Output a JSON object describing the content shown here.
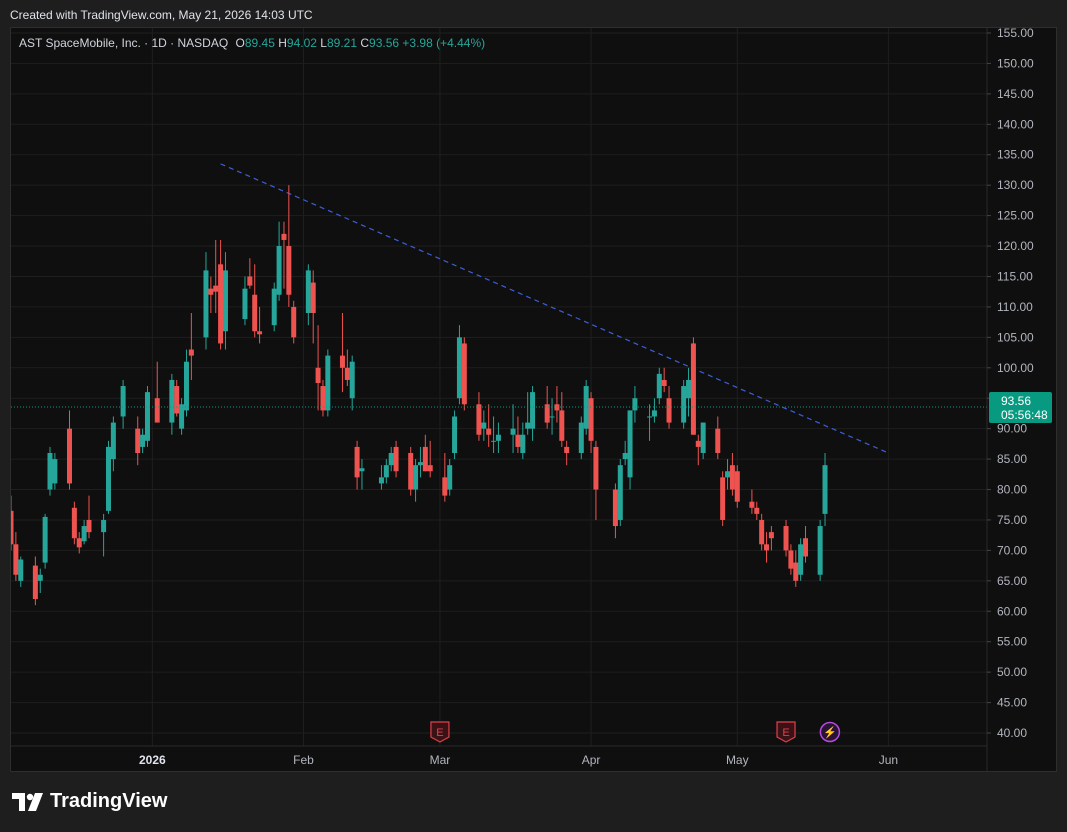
{
  "header": {
    "created_text": "Created with TradingView.com, May 21, 2026 14:03 UTC"
  },
  "legend": {
    "symbol": "AST SpaceMobile, Inc. · 1D · NASDAQ",
    "o_label": "O",
    "o_value": "89.45",
    "h_label": "H",
    "h_value": "94.02",
    "l_label": "L",
    "l_value": "89.21",
    "c_label": "C",
    "c_value": "93.56",
    "change": "+3.98 (+4.44%)"
  },
  "price_tag": {
    "price": "93.56",
    "countdown": "05:56:48"
  },
  "footer": {
    "brand": "TradingView"
  },
  "colors": {
    "up": "#26a69a",
    "down": "#ef5350",
    "trendline": "#3d5fd9",
    "background": "#0f0f0f",
    "event": "#e0404a",
    "dividend": "#b44cde"
  },
  "chart_data": {
    "type": "candlestick",
    "title": "AST SpaceMobile, Inc. · 1D · NASDAQ",
    "ylim": [
      40,
      155
    ],
    "y_ticks": [
      "155.00",
      "150.00",
      "145.00",
      "140.00",
      "135.00",
      "130.00",
      "125.00",
      "120.00",
      "115.00",
      "110.00",
      "105.00",
      "100.00",
      "95.00",
      "90.00",
      "85.00",
      "80.00",
      "75.00",
      "70.00",
      "65.00",
      "60.00",
      "55.00",
      "50.00",
      "45.00",
      "40.00"
    ],
    "x_ticks": [
      {
        "label": "2026",
        "date": "2026-01-01",
        "bold": true
      },
      {
        "label": "Feb",
        "date": "2026-02-01",
        "bold": false
      },
      {
        "label": "Mar",
        "date": "2026-03-01",
        "bold": false
      },
      {
        "label": "Apr",
        "date": "2026-04-01",
        "bold": false
      },
      {
        "label": "May",
        "date": "2026-05-01",
        "bold": false
      },
      {
        "label": "Jun",
        "date": "2026-06-01",
        "bold": false
      }
    ],
    "x_range": [
      "2025-12-03",
      "2026-06-20"
    ],
    "grid": true,
    "current_price": 93.56,
    "trendline": {
      "style": "dashed",
      "start": {
        "date": "2026-01-15",
        "price": 133.5
      },
      "end": {
        "date": "2026-06-01",
        "price": 86.0
      }
    },
    "events": [
      {
        "date": "2026-03-01",
        "type": "earnings",
        "label": "E"
      },
      {
        "date": "2026-05-11",
        "type": "earnings",
        "label": "E"
      },
      {
        "date": "2026-05-20",
        "type": "dividend",
        "label": "⚡"
      }
    ],
    "candles": [
      {
        "date": "2025-12-03",
        "o": 76.5,
        "h": 79,
        "l": 70,
        "c": 71
      },
      {
        "date": "2025-12-04",
        "o": 71,
        "h": 73,
        "l": 65,
        "c": 66
      },
      {
        "date": "2025-12-05",
        "o": 65,
        "h": 69,
        "l": 64,
        "c": 68.5
      },
      {
        "date": "2025-12-08",
        "o": 67.5,
        "h": 69,
        "l": 61,
        "c": 62
      },
      {
        "date": "2025-12-09",
        "o": 65,
        "h": 67,
        "l": 63,
        "c": 66
      },
      {
        "date": "2025-12-10",
        "o": 68,
        "h": 76,
        "l": 67,
        "c": 75.5
      },
      {
        "date": "2025-12-11",
        "o": 80,
        "h": 87,
        "l": 79,
        "c": 86
      },
      {
        "date": "2025-12-12",
        "o": 81,
        "h": 86,
        "l": 80,
        "c": 85
      },
      {
        "date": "2025-12-15",
        "o": 90,
        "h": 93,
        "l": 80,
        "c": 81
      },
      {
        "date": "2025-12-16",
        "o": 77,
        "h": 78,
        "l": 71,
        "c": 72
      },
      {
        "date": "2025-12-17",
        "o": 72,
        "h": 73,
        "l": 69.5,
        "c": 70.5
      },
      {
        "date": "2025-12-18",
        "o": 71.5,
        "h": 75,
        "l": 71,
        "c": 74
      },
      {
        "date": "2025-12-19",
        "o": 75,
        "h": 79,
        "l": 72,
        "c": 73
      },
      {
        "date": "2025-12-22",
        "o": 73,
        "h": 76,
        "l": 69,
        "c": 75
      },
      {
        "date": "2025-12-23",
        "o": 76.5,
        "h": 88,
        "l": 76,
        "c": 87
      },
      {
        "date": "2025-12-24",
        "o": 85,
        "h": 92,
        "l": 83,
        "c": 91
      },
      {
        "date": "2025-12-26",
        "o": 92,
        "h": 98,
        "l": 90,
        "c": 97
      },
      {
        "date": "2025-12-29",
        "o": 90,
        "h": 92,
        "l": 84,
        "c": 86
      },
      {
        "date": "2025-12-30",
        "o": 87,
        "h": 90,
        "l": 86,
        "c": 89
      },
      {
        "date": "2025-12-31",
        "o": 88,
        "h": 97,
        "l": 87,
        "c": 96
      },
      {
        "date": "2026-01-02",
        "o": 95,
        "h": 101,
        "l": 91,
        "c": 91
      },
      {
        "date": "2026-01-05",
        "o": 91,
        "h": 99,
        "l": 89,
        "c": 98
      },
      {
        "date": "2026-01-06",
        "o": 97,
        "h": 98,
        "l": 92,
        "c": 92.5
      },
      {
        "date": "2026-01-07",
        "o": 90,
        "h": 95,
        "l": 89,
        "c": 94
      },
      {
        "date": "2026-01-08",
        "o": 93,
        "h": 103,
        "l": 92,
        "c": 101
      },
      {
        "date": "2026-01-09",
        "o": 103,
        "h": 109,
        "l": 98,
        "c": 102
      },
      {
        "date": "2026-01-12",
        "o": 105,
        "h": 119,
        "l": 103,
        "c": 116
      },
      {
        "date": "2026-01-13",
        "o": 113,
        "h": 115,
        "l": 109,
        "c": 112
      },
      {
        "date": "2026-01-14",
        "o": 113.5,
        "h": 121,
        "l": 109,
        "c": 112.5
      },
      {
        "date": "2026-01-15",
        "o": 117,
        "h": 121,
        "l": 103,
        "c": 104
      },
      {
        "date": "2026-01-16",
        "o": 106,
        "h": 119,
        "l": 103,
        "c": 116
      },
      {
        "date": "2026-01-20",
        "o": 108,
        "h": 115,
        "l": 107,
        "c": 113
      },
      {
        "date": "2026-01-21",
        "o": 115,
        "h": 118,
        "l": 113,
        "c": 113.5
      },
      {
        "date": "2026-01-22",
        "o": 112,
        "h": 117,
        "l": 105,
        "c": 106
      },
      {
        "date": "2026-01-23",
        "o": 106,
        "h": 110,
        "l": 104,
        "c": 105.5
      },
      {
        "date": "2026-01-26",
        "o": 107,
        "h": 114,
        "l": 106,
        "c": 113
      },
      {
        "date": "2026-01-27",
        "o": 112,
        "h": 124,
        "l": 111,
        "c": 120
      },
      {
        "date": "2026-01-28",
        "o": 122,
        "h": 124,
        "l": 113,
        "c": 121
      },
      {
        "date": "2026-01-29",
        "o": 120,
        "h": 130,
        "l": 110,
        "c": 112
      },
      {
        "date": "2026-01-30",
        "o": 110,
        "h": 111,
        "l": 104,
        "c": 105
      },
      {
        "date": "2026-02-02",
        "o": 109,
        "h": 117,
        "l": 107,
        "c": 116
      },
      {
        "date": "2026-02-03",
        "o": 114,
        "h": 116,
        "l": 104,
        "c": 109
      },
      {
        "date": "2026-02-04",
        "o": 100,
        "h": 107,
        "l": 93,
        "c": 97.5
      },
      {
        "date": "2026-02-05",
        "o": 97,
        "h": 98,
        "l": 92,
        "c": 93
      },
      {
        "date": "2026-02-06",
        "o": 93,
        "h": 103,
        "l": 92,
        "c": 102
      },
      {
        "date": "2026-02-09",
        "o": 102,
        "h": 109,
        "l": 96,
        "c": 100
      },
      {
        "date": "2026-02-10",
        "o": 100,
        "h": 103,
        "l": 97,
        "c": 98
      },
      {
        "date": "2026-02-11",
        "o": 95,
        "h": 102,
        "l": 93,
        "c": 101
      },
      {
        "date": "2026-02-12",
        "o": 87,
        "h": 88,
        "l": 80,
        "c": 82
      },
      {
        "date": "2026-02-13",
        "o": 83,
        "h": 85,
        "l": 80,
        "c": 83.5
      },
      {
        "date": "2026-02-17",
        "o": 81,
        "h": 84,
        "l": 80,
        "c": 82
      },
      {
        "date": "2026-02-18",
        "o": 82,
        "h": 85,
        "l": 81,
        "c": 84
      },
      {
        "date": "2026-02-19",
        "o": 84,
        "h": 87,
        "l": 83,
        "c": 86
      },
      {
        "date": "2026-02-20",
        "o": 87,
        "h": 88,
        "l": 82,
        "c": 83
      },
      {
        "date": "2026-02-23",
        "o": 86,
        "h": 87,
        "l": 79,
        "c": 80
      },
      {
        "date": "2026-02-24",
        "o": 80,
        "h": 85,
        "l": 78,
        "c": 84
      },
      {
        "date": "2026-02-25",
        "o": 84,
        "h": 87,
        "l": 82,
        "c": 84.5
      },
      {
        "date": "2026-02-26",
        "o": 87,
        "h": 89,
        "l": 83,
        "c": 83
      },
      {
        "date": "2026-02-27",
        "o": 84,
        "h": 88,
        "l": 82,
        "c": 83
      },
      {
        "date": "2026-03-02",
        "o": 82,
        "h": 86,
        "l": 78,
        "c": 79
      },
      {
        "date": "2026-03-03",
        "o": 80,
        "h": 85,
        "l": 79,
        "c": 84
      },
      {
        "date": "2026-03-04",
        "o": 86,
        "h": 93,
        "l": 85,
        "c": 92
      },
      {
        "date": "2026-03-05",
        "o": 95,
        "h": 107,
        "l": 94,
        "c": 105
      },
      {
        "date": "2026-03-06",
        "o": 104,
        "h": 105,
        "l": 93,
        "c": 94
      },
      {
        "date": "2026-03-09",
        "o": 94,
        "h": 96,
        "l": 88,
        "c": 89
      },
      {
        "date": "2026-03-10",
        "o": 90,
        "h": 93,
        "l": 88,
        "c": 91
      },
      {
        "date": "2026-03-11",
        "o": 90,
        "h": 94,
        "l": 87,
        "c": 89
      },
      {
        "date": "2026-03-12",
        "o": 88,
        "h": 92,
        "l": 86,
        "c": 88
      },
      {
        "date": "2026-03-13",
        "o": 88,
        "h": 91,
        "l": 86,
        "c": 89
      },
      {
        "date": "2026-03-16",
        "o": 89,
        "h": 94,
        "l": 86,
        "c": 90
      },
      {
        "date": "2026-03-17",
        "o": 89,
        "h": 92,
        "l": 86,
        "c": 87
      },
      {
        "date": "2026-03-18",
        "o": 86,
        "h": 91,
        "l": 85,
        "c": 89
      },
      {
        "date": "2026-03-19",
        "o": 90,
        "h": 96,
        "l": 89,
        "c": 91
      },
      {
        "date": "2026-03-20",
        "o": 90,
        "h": 97,
        "l": 88,
        "c": 96
      },
      {
        "date": "2026-03-23",
        "o": 94,
        "h": 97,
        "l": 90,
        "c": 91
      },
      {
        "date": "2026-03-24",
        "o": 92,
        "h": 95,
        "l": 89,
        "c": 92
      },
      {
        "date": "2026-03-25",
        "o": 94,
        "h": 97,
        "l": 91,
        "c": 93
      },
      {
        "date": "2026-03-26",
        "o": 93,
        "h": 96,
        "l": 87,
        "c": 88
      },
      {
        "date": "2026-03-27",
        "o": 87,
        "h": 88,
        "l": 84,
        "c": 86
      },
      {
        "date": "2026-03-30",
        "o": 86,
        "h": 92,
        "l": 85,
        "c": 91
      },
      {
        "date": "2026-03-31",
        "o": 90,
        "h": 98,
        "l": 89,
        "c": 97
      },
      {
        "date": "2026-04-01",
        "o": 95,
        "h": 96,
        "l": 86,
        "c": 88
      },
      {
        "date": "2026-04-02",
        "o": 87,
        "h": 88,
        "l": 75,
        "c": 80
      },
      {
        "date": "2026-04-06",
        "o": 80,
        "h": 81,
        "l": 72,
        "c": 74
      },
      {
        "date": "2026-04-07",
        "o": 75,
        "h": 85,
        "l": 74,
        "c": 84
      },
      {
        "date": "2026-04-08",
        "o": 85,
        "h": 88,
        "l": 84,
        "c": 86
      },
      {
        "date": "2026-04-09",
        "o": 82,
        "h": 93,
        "l": 80,
        "c": 93
      },
      {
        "date": "2026-04-10",
        "o": 93,
        "h": 97,
        "l": 91,
        "c": 95
      },
      {
        "date": "2026-04-13",
        "o": 92,
        "h": 94,
        "l": 88,
        "c": 92
      },
      {
        "date": "2026-04-14",
        "o": 92,
        "h": 95,
        "l": 91,
        "c": 93
      },
      {
        "date": "2026-04-15",
        "o": 95,
        "h": 100,
        "l": 94,
        "c": 99
      },
      {
        "date": "2026-04-16",
        "o": 98,
        "h": 100,
        "l": 96,
        "c": 97
      },
      {
        "date": "2026-04-17",
        "o": 95,
        "h": 97,
        "l": 90,
        "c": 91
      },
      {
        "date": "2026-04-20",
        "o": 91,
        "h": 98,
        "l": 90,
        "c": 97
      },
      {
        "date": "2026-04-21",
        "o": 95,
        "h": 100,
        "l": 92,
        "c": 98
      },
      {
        "date": "2026-04-22",
        "o": 104,
        "h": 105,
        "l": 89,
        "c": 89
      },
      {
        "date": "2026-04-23",
        "o": 88,
        "h": 89,
        "l": 84,
        "c": 87
      },
      {
        "date": "2026-04-24",
        "o": 86,
        "h": 91,
        "l": 85,
        "c": 91
      },
      {
        "date": "2026-04-27",
        "o": 90,
        "h": 92,
        "l": 85,
        "c": 86
      },
      {
        "date": "2026-04-28",
        "o": 82,
        "h": 83,
        "l": 74,
        "c": 75
      },
      {
        "date": "2026-04-29",
        "o": 82,
        "h": 85,
        "l": 80,
        "c": 83
      },
      {
        "date": "2026-04-30",
        "o": 84,
        "h": 86,
        "l": 79,
        "c": 80
      },
      {
        "date": "2026-05-01",
        "o": 83,
        "h": 84,
        "l": 77,
        "c": 78
      },
      {
        "date": "2026-05-04",
        "o": 78,
        "h": 80,
        "l": 76,
        "c": 77
      },
      {
        "date": "2026-05-05",
        "o": 77,
        "h": 78,
        "l": 75,
        "c": 76
      },
      {
        "date": "2026-05-06",
        "o": 75,
        "h": 76,
        "l": 70,
        "c": 71
      },
      {
        "date": "2026-05-07",
        "o": 71,
        "h": 73,
        "l": 68,
        "c": 70
      },
      {
        "date": "2026-05-08",
        "o": 73,
        "h": 74,
        "l": 70,
        "c": 72
      },
      {
        "date": "2026-05-11",
        "o": 74,
        "h": 75,
        "l": 69,
        "c": 70
      },
      {
        "date": "2026-05-12",
        "o": 70,
        "h": 71,
        "l": 66,
        "c": 67
      },
      {
        "date": "2026-05-13",
        "o": 68,
        "h": 70,
        "l": 64,
        "c": 65
      },
      {
        "date": "2026-05-14",
        "o": 66,
        "h": 72,
        "l": 65,
        "c": 71
      },
      {
        "date": "2026-05-15",
        "o": 72,
        "h": 74,
        "l": 68,
        "c": 69
      },
      {
        "date": "2026-05-18",
        "o": 66,
        "h": 75,
        "l": 65,
        "c": 74
      },
      {
        "date": "2026-05-19",
        "o": 76,
        "h": 86,
        "l": 74,
        "c": 84
      }
    ]
  }
}
